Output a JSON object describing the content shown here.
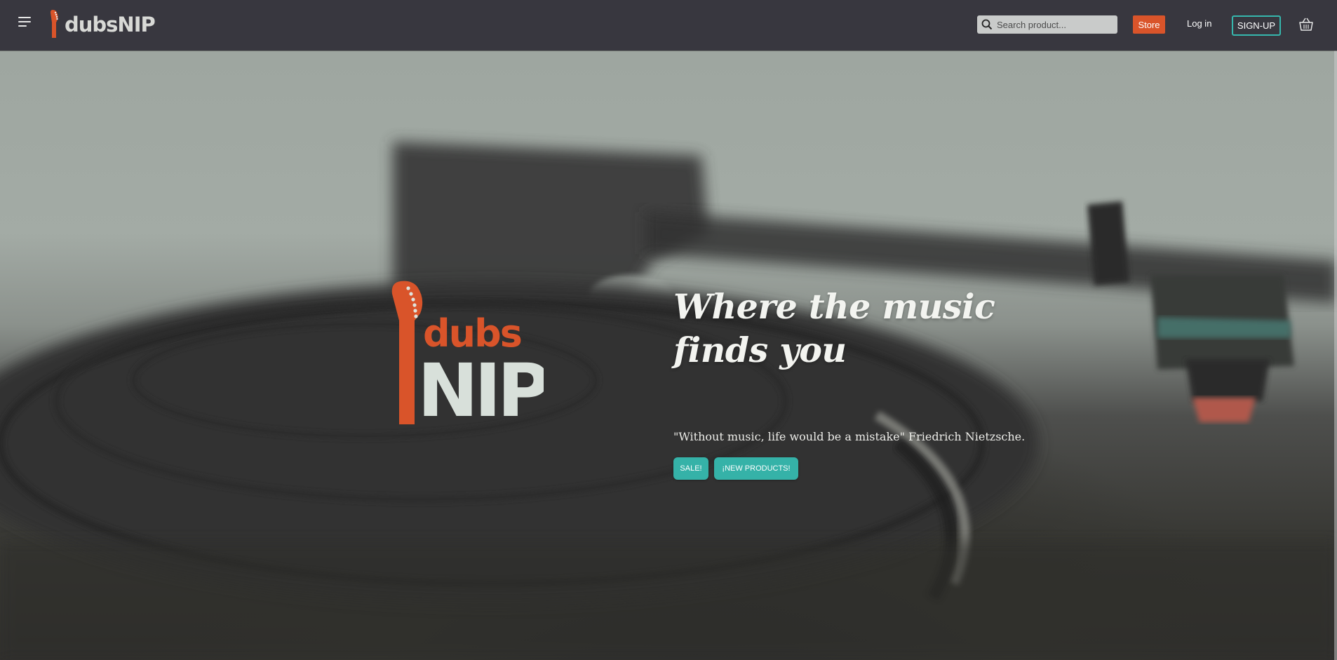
{
  "navbar": {
    "brand_text": "dubsNIP",
    "search_placeholder": "Search product...",
    "store_label": "Store",
    "login_label": "Log in",
    "signup_label": "SIGN-UP"
  },
  "hero": {
    "logo_top": "dubs",
    "logo_bottom": "NIP",
    "title": "Where the music finds you",
    "quote": "\"Without music, life would be a mistake\" Friedrich Nietzsche.",
    "sale_label": "SALE!",
    "new_products_label": "¡NEW PRODUCTS!"
  },
  "colors": {
    "navbar_bg": "#38373f",
    "accent_orange": "#d9542a",
    "accent_teal": "#35b2a8",
    "logo_light": "#d8e0da"
  },
  "icons": [
    "menu-icon",
    "guitar-logo-icon",
    "search-icon",
    "basket-icon"
  ]
}
